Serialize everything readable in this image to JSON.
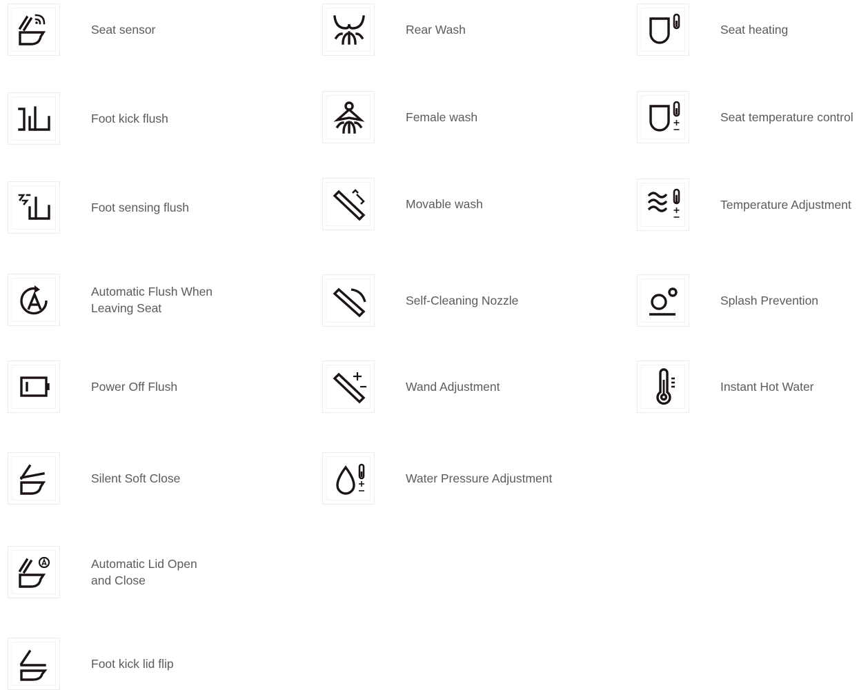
{
  "features": {
    "seat_sensor": {
      "label": "Seat sensor",
      "icon": "seat-sensor-icon"
    },
    "foot_kick_flush": {
      "label": "Foot kick flush",
      "icon": "foot-kick-flush-icon"
    },
    "foot_sensing_flush": {
      "label": "Foot sensing flush",
      "icon": "foot-sensing-flush-icon"
    },
    "auto_flush_leaving": {
      "label": "Automatic Flush When\nLeaving Seat",
      "icon": "auto-flush-icon"
    },
    "power_off_flush": {
      "label": "Power Off Flush",
      "icon": "battery-icon"
    },
    "silent_soft_close": {
      "label": "Silent Soft Close",
      "icon": "soft-close-icon"
    },
    "auto_lid": {
      "label": "Automatic Lid Open\nand Close",
      "icon": "auto-lid-icon"
    },
    "foot_kick_lid_flip": {
      "label": "Foot kick lid flip",
      "icon": "lid-flip-icon"
    },
    "rear_wash": {
      "label": "Rear Wash",
      "icon": "rear-wash-icon"
    },
    "female_wash": {
      "label": "Female wash",
      "icon": "female-wash-icon"
    },
    "movable_wash": {
      "label": "Movable wash",
      "icon": "movable-wash-icon"
    },
    "self_cleaning_nozzle": {
      "label": "Self-Cleaning Nozzle",
      "icon": "self-cleaning-nozzle-icon"
    },
    "wand_adjustment": {
      "label": "Wand Adjustment",
      "icon": "wand-adjustment-icon"
    },
    "water_pressure": {
      "label": "Water Pressure Adjustment",
      "icon": "water-pressure-icon"
    },
    "seat_heating": {
      "label": "Seat heating",
      "icon": "seat-heating-icon"
    },
    "seat_temp_control": {
      "label": "Seat temperature control",
      "icon": "seat-temperature-icon"
    },
    "temp_adjustment": {
      "label": "Temperature Adjustment",
      "icon": "temperature-adjustment-icon"
    },
    "splash_prevention": {
      "label": "Splash Prevention",
      "icon": "splash-prevention-icon"
    },
    "instant_hot_water": {
      "label": "Instant Hot Water",
      "icon": "thermometer-icon"
    }
  },
  "colors": {
    "icon": "#1c1414",
    "label": "#5b5b5b",
    "box_border": "#ececec"
  }
}
